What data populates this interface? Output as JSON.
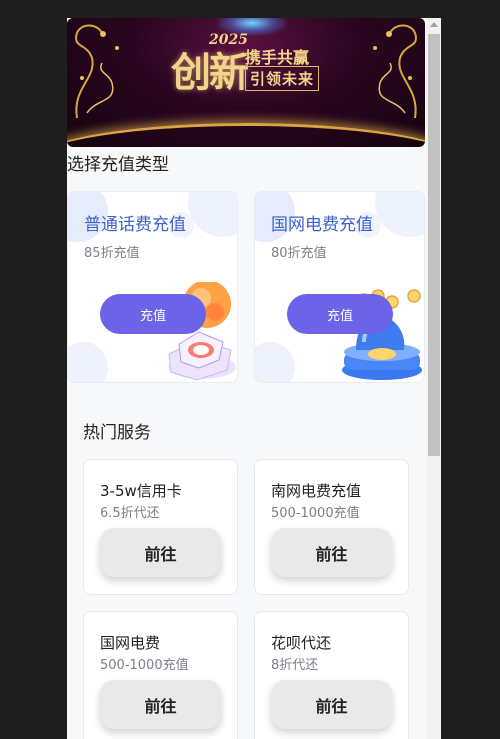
{
  "banner": {
    "year": "2025",
    "title": "创新",
    "slogan_top": "携手共赢",
    "slogan_bottom": "引领未来"
  },
  "recharge": {
    "section_title": "选择充值类型",
    "cards": [
      {
        "name": "普通话费充值",
        "desc": "85折充值",
        "button": "充值",
        "icon": "orange-gem-icon"
      },
      {
        "name": "国网电费充值",
        "desc": "80折充值",
        "button": "充值",
        "icon": "blue-coin-jar-icon"
      }
    ]
  },
  "hot": {
    "title": "热门服务",
    "items": [
      {
        "name": "3-5w信用卡",
        "desc": "6.5折代还",
        "button": "前往"
      },
      {
        "name": "南网电费充值",
        "desc": "500-1000充值",
        "button": "前往"
      },
      {
        "name": "国网电费",
        "desc": "500-1000充值",
        "button": "前往"
      },
      {
        "name": "花呗代还",
        "desc": "8折代还",
        "button": "前往"
      }
    ]
  },
  "colors": {
    "accent_button": "#6c63e8",
    "card_title": "#3d63c9",
    "banner_gold": "#f2d58a"
  }
}
